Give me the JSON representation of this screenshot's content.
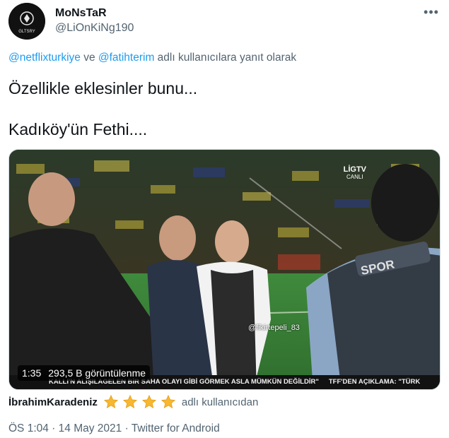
{
  "user": {
    "display_name": "MoNsTaR",
    "handle": "@LiOnKiNg190",
    "avatar_text": "GLTSRY"
  },
  "reply": {
    "mention_1": "@netflixturkiye",
    "connector": " ve ",
    "mention_2": "@fatihterim",
    "suffix": " adlı kullanıcılara yanıt olarak"
  },
  "tweet": {
    "line_1": "Özellikle eklesinler bunu...",
    "line_2": "Kadıköy'ün Fethi...."
  },
  "media": {
    "channel_logo": "LİGTV",
    "channel_sub": "CANLI",
    "watermark": "@fikirtepeli_83",
    "ticker_1": "KALLI'N ALIŞILAGELEN BİR SAHA OLAYI GİBİ GÖRMEK ASLA MÜMKÜN DEĞİLDİR\"",
    "ticker_2": "TFF'DEN AÇIKLAMA: \"TÜRK",
    "duration": "1:35",
    "views": "293,5 B görüntülenme"
  },
  "source": {
    "username": "İbrahimKaradeniz",
    "star_count": 4,
    "star_icon": "star-emoji-icon",
    "suffix": "adlı kullanıcıdan"
  },
  "meta": {
    "time": "ÖS 1:04",
    "separator_1": " · ",
    "date": "14 May 2021",
    "separator_2": " · ",
    "client": "Twitter for Android"
  },
  "colors": {
    "link": "#1d9bf0",
    "secondary_text": "#536471",
    "primary_text": "#0f1419"
  }
}
